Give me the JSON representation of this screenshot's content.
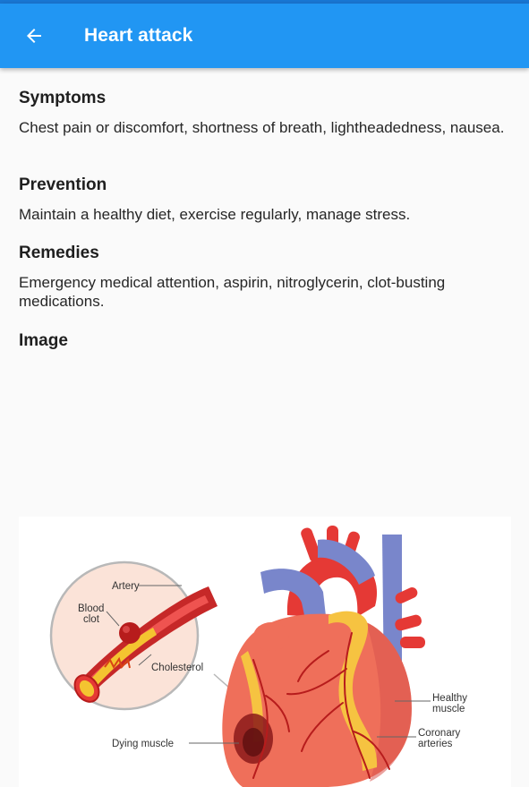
{
  "app_bar": {
    "title": "Heart attack",
    "back_icon": "arrow-back-icon",
    "background": "#2196f3",
    "status_bar_color": "#1976d2"
  },
  "sections": [
    {
      "title": "Symptoms",
      "body": "Chest pain or discomfort, shortness of breath, lightheadedness, nausea."
    },
    {
      "title": "Prevention",
      "body": "Maintain a healthy diet, exercise regularly, manage stress."
    },
    {
      "title": "Remedies",
      "body": "Emergency medical attention, aspirin, nitroglycerin, clot-busting medications."
    },
    {
      "title": "Image"
    }
  ],
  "illustration": {
    "labels": {
      "artery": "Artery",
      "blood_clot_line1": "Blood",
      "blood_clot_line2": "clot",
      "cholesterol": "Cholesterol",
      "dying_muscle": "Dying muscle",
      "healthy_muscle_line1": "Healthy",
      "healthy_muscle_line2": "muscle",
      "coronary_arteries_line1": "Coronary",
      "coronary_arteries_line2": "arteries"
    }
  }
}
